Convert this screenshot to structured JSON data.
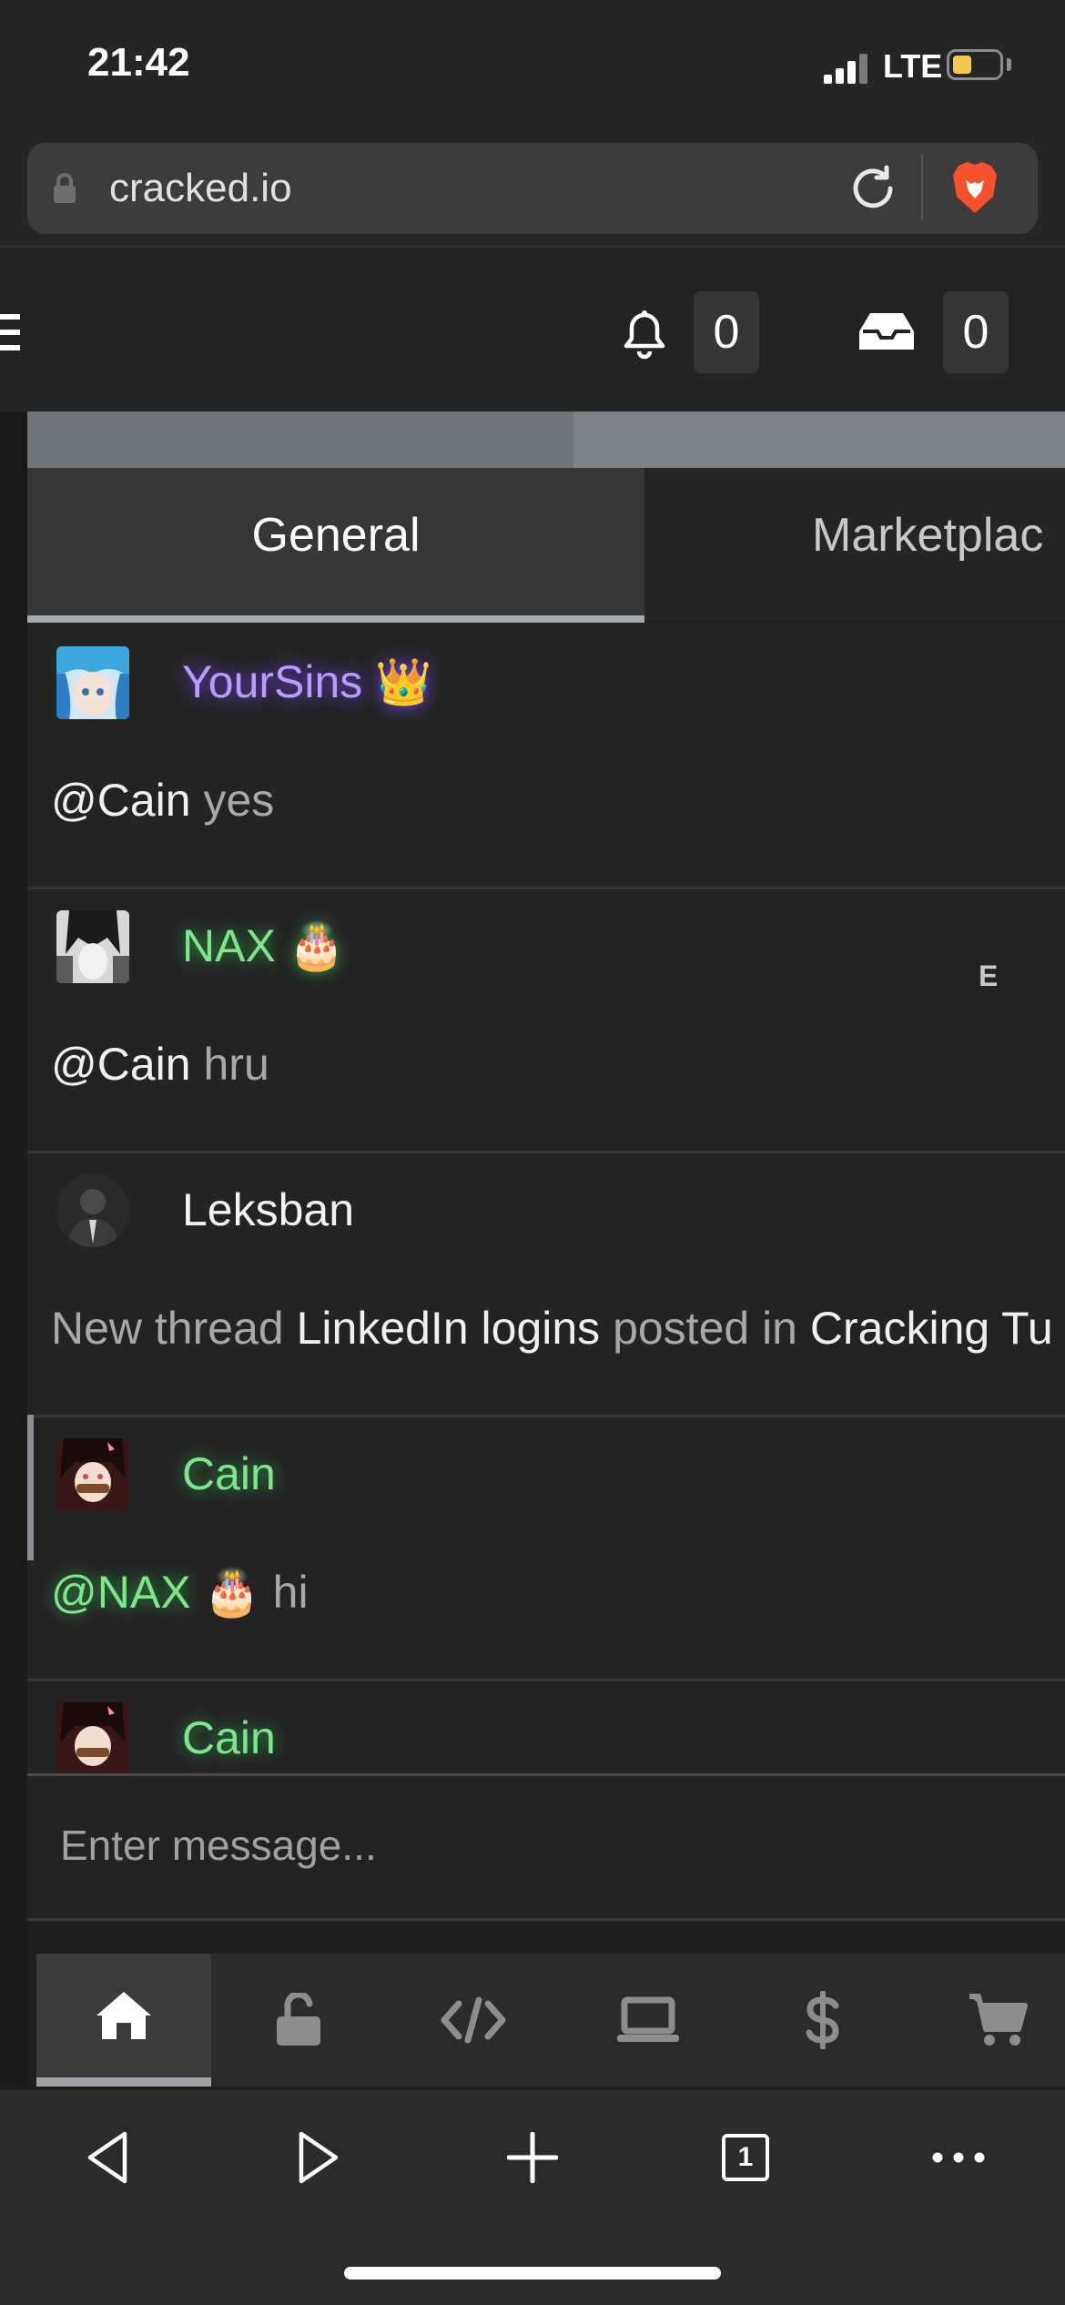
{
  "status_bar": {
    "time": "21:42",
    "network": "LTE"
  },
  "browser": {
    "url": "cracked.io"
  },
  "header": {
    "notifications_count": "0",
    "inbox_count": "0"
  },
  "tabs": [
    {
      "label": "General",
      "active": true
    },
    {
      "label": "Marketplac",
      "active": false
    }
  ],
  "messages": [
    {
      "username": "YourSins",
      "badge": "👑",
      "mention": "@Cain",
      "text": " yes",
      "name_color": "#b99bff"
    },
    {
      "username": "NAX",
      "badge": "🎂",
      "tag": "E",
      "mention": "@Cain",
      "text": " hru",
      "name_color": "#7de68a"
    },
    {
      "username": "Leksban",
      "text_parts": [
        "New thread ",
        "LinkedIn logins",
        " posted in ",
        "Cracking Tu"
      ],
      "name_color": "#f2f2f2"
    },
    {
      "username": "Cain",
      "mention": "@NAX",
      "mention_badge": "🎂",
      "text": " hi",
      "name_color": "#7de68a"
    },
    {
      "username": "Cain",
      "name_color": "#7de68a"
    }
  ],
  "composer": {
    "placeholder": "Enter message..."
  },
  "categories": [
    "home-icon",
    "unlock-icon",
    "code-icon",
    "laptop-icon",
    "dollar-icon",
    "cart-icon"
  ],
  "browser_toolbar": {
    "tabs_count": "1"
  }
}
